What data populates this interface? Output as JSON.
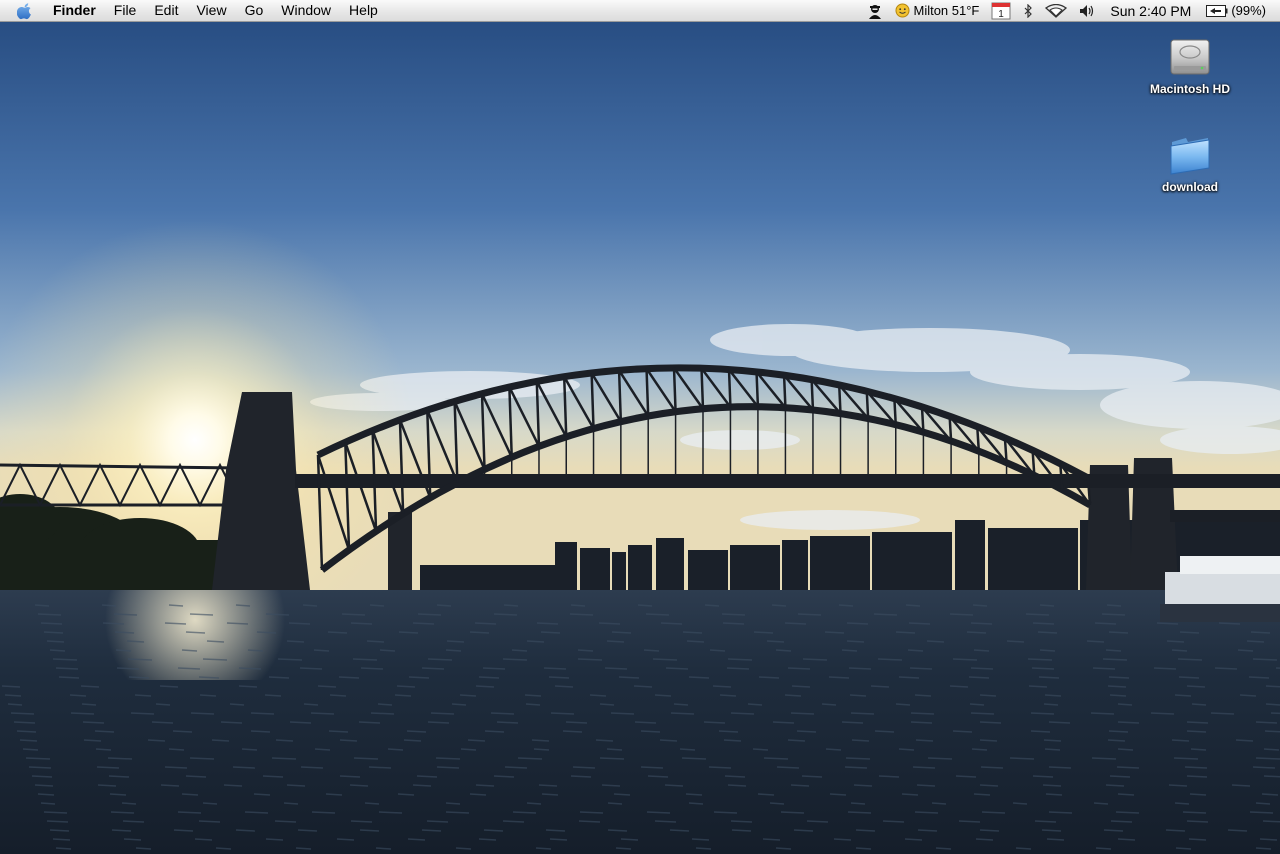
{
  "menubar": {
    "app_name": "Finder",
    "menus": [
      "File",
      "Edit",
      "View",
      "Go",
      "Window",
      "Help"
    ],
    "extras": {
      "weather_text": "Milton 51°F",
      "calendar_day": "1",
      "clock": "Sun 2:40 PM",
      "battery": "(99%)"
    },
    "icons": [
      "apple-icon",
      "spy-icon",
      "weather-sun-icon",
      "calendar-icon",
      "bluetooth-icon",
      "wifi-icon",
      "volume-icon",
      "battery-icon"
    ]
  },
  "desktop": {
    "icons": [
      {
        "label": "Macintosh HD",
        "icon": "hard-drive-icon"
      },
      {
        "label": "download",
        "icon": "folder-icon"
      }
    ],
    "wallpaper": "harbour-bridge-sunset"
  },
  "colors": {
    "menubar": "#e6e6e6",
    "sky_top": "#2b5288",
    "water": "#1c2a3a",
    "label_text": "#ffffff"
  }
}
